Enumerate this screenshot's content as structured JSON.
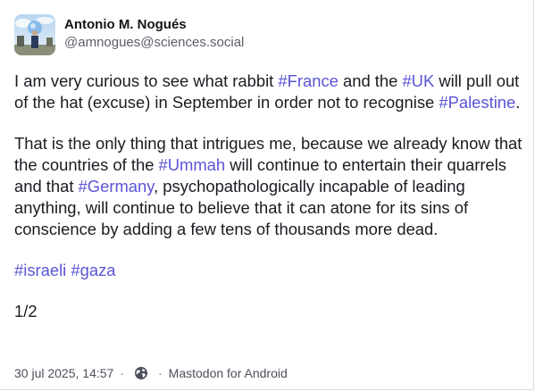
{
  "author": {
    "display_name": "Antonio M. Nogués",
    "handle": "@amnogues@sciences.social",
    "avatar_icon": "profile-photo"
  },
  "post": {
    "p1": {
      "t1": "I am very curious to see what rabbit ",
      "tag_france": "#France",
      "t2": " and the ",
      "tag_uk": "#UK",
      "t3": " will pull out of the hat (excuse) in September in order not to recognise ",
      "tag_palestine": "#Palestine",
      "t4": "."
    },
    "p2": {
      "t1": "That is the only thing that intrigues me, because we already know that the countries of the ",
      "tag_ummah": "#Ummah",
      "t2": " will continue to entertain their quarrels and that ",
      "tag_germany": "#Germany",
      "t3": ", psychopathologically incapable of leading anything, will continue to believe that it can atone for its sins of conscience by adding a few tens of thousands more dead."
    },
    "tags": {
      "israeli": "#israeli",
      "space": " ",
      "gaza": "#gaza"
    },
    "thread_counter": "1/2"
  },
  "meta": {
    "timestamp": "30 jul 2025, 14:57",
    "separator": "·",
    "visibility_icon": "globe-icon",
    "client": "Mastodon for Android"
  },
  "colors": {
    "hashtag": "#5a55d6",
    "text": "#1b1b22",
    "secondary": "#5c5e6b"
  }
}
